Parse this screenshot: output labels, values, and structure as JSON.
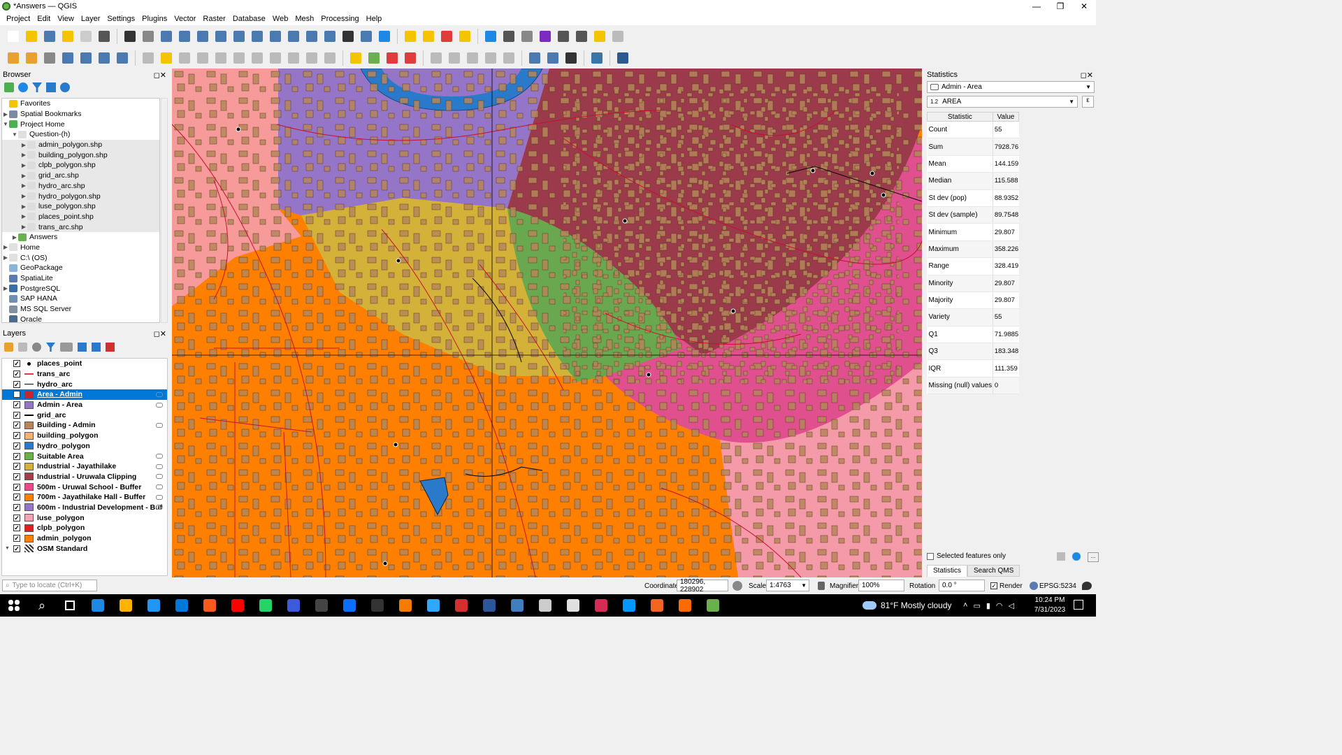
{
  "window": {
    "title": "*Answers — QGIS",
    "minimize": "—",
    "restore": "❐",
    "close": "✕"
  },
  "menu": [
    "Project",
    "Edit",
    "View",
    "Layer",
    "Settings",
    "Plugins",
    "Vector",
    "Raster",
    "Database",
    "Web",
    "Mesh",
    "Processing",
    "Help"
  ],
  "browser": {
    "title": "Browser",
    "items": [
      {
        "label": "Favorites",
        "indent": 0,
        "arrow": "",
        "icon": "#f5c400"
      },
      {
        "label": "Spatial Bookmarks",
        "indent": 0,
        "arrow": "▶",
        "icon": "#7a8aa0"
      },
      {
        "label": "Project Home",
        "indent": 0,
        "arrow": "▼",
        "icon": "#4caf50"
      },
      {
        "label": "Question-(h)",
        "indent": 1,
        "arrow": "▼",
        "icon": "#e0e0e0"
      },
      {
        "label": "admin_polygon.shp",
        "indent": 2,
        "arrow": "▶",
        "icon": "#ddd"
      },
      {
        "label": "building_polygon.shp",
        "indent": 2,
        "arrow": "▶",
        "icon": "#ddd"
      },
      {
        "label": "clpb_polygon.shp",
        "indent": 2,
        "arrow": "▶",
        "icon": "#ddd"
      },
      {
        "label": "grid_arc.shp",
        "indent": 2,
        "arrow": "▶",
        "icon": "#ddd"
      },
      {
        "label": "hydro_arc.shp",
        "indent": 2,
        "arrow": "▶",
        "icon": "#ddd"
      },
      {
        "label": "hydro_polygon.shp",
        "indent": 2,
        "arrow": "▶",
        "icon": "#ddd"
      },
      {
        "label": "luse_polygon.shp",
        "indent": 2,
        "arrow": "▶",
        "icon": "#ddd"
      },
      {
        "label": "places_point.shp",
        "indent": 2,
        "arrow": "▶",
        "icon": "#ddd"
      },
      {
        "label": "trans_arc.shp",
        "indent": 2,
        "arrow": "▶",
        "icon": "#ddd"
      },
      {
        "label": "Answers",
        "indent": 1,
        "arrow": "▶",
        "icon": "#6ab04c"
      },
      {
        "label": "Home",
        "indent": 0,
        "arrow": "▶",
        "icon": "#e0e0e0"
      },
      {
        "label": "C:\\ (OS)",
        "indent": 0,
        "arrow": "▶",
        "icon": "#e0e0e0"
      },
      {
        "label": "GeoPackage",
        "indent": 0,
        "arrow": "",
        "icon": "#8ab4d8"
      },
      {
        "label": "SpatiaLite",
        "indent": 0,
        "arrow": "",
        "icon": "#5a7ab0"
      },
      {
        "label": "PostgreSQL",
        "indent": 0,
        "arrow": "▶",
        "icon": "#3a6ea5"
      },
      {
        "label": "SAP HANA",
        "indent": 0,
        "arrow": "",
        "icon": "#7090b0"
      },
      {
        "label": "MS SQL Server",
        "indent": 0,
        "arrow": "",
        "icon": "#8090a0"
      },
      {
        "label": "Oracle",
        "indent": 0,
        "arrow": "",
        "icon": "#4a6a90"
      }
    ]
  },
  "layers": {
    "title": "Layers",
    "items": [
      {
        "label": "places_point",
        "sym": "point",
        "color": "#000000",
        "selected": false,
        "eye": false
      },
      {
        "label": "trans_arc",
        "sym": "line",
        "color": "#e03c3c",
        "selected": false,
        "eye": false
      },
      {
        "label": "hydro_arc",
        "sym": "line",
        "color": "#000000",
        "selected": false,
        "eye": false
      },
      {
        "label": "Area - Admin",
        "sym": "fill",
        "color": "#c8262e",
        "selected": true,
        "eye": true
      },
      {
        "label": "Admin - Area",
        "sym": "fill",
        "color": "#9575c8",
        "selected": false,
        "eye": true
      },
      {
        "label": "grid_arc",
        "sym": "line",
        "color": "#000000",
        "selected": false,
        "eye": false
      },
      {
        "label": "Building - Admin",
        "sym": "fill",
        "color": "#b5865a",
        "selected": false,
        "eye": true
      },
      {
        "label": "building_polygon",
        "sym": "fill",
        "color": "#f4b26a",
        "selected": false,
        "eye": false
      },
      {
        "label": "hydro_polygon",
        "sym": "fill",
        "color": "#2a7acc",
        "selected": false,
        "eye": false
      },
      {
        "label": "Suitable Area",
        "sym": "fill",
        "color": "#6ab04c",
        "selected": false,
        "eye": true
      },
      {
        "label": "Industrial - Jayathilake",
        "sym": "fill",
        "color": "#d4b23a",
        "selected": false,
        "eye": true
      },
      {
        "label": "Industrial - Uruwala Clipping",
        "sym": "fill",
        "color": "#a83a4a",
        "selected": false,
        "eye": true
      },
      {
        "label": "500m - Uruwal School - Buffer",
        "sym": "fill",
        "color": "#e84a8a",
        "selected": false,
        "eye": true
      },
      {
        "label": "700m - Jayathilake Hall - Buffer",
        "sym": "fill",
        "color": "#ff8000",
        "selected": false,
        "eye": true
      },
      {
        "label": "600m - Industrial Development - Buf",
        "sym": "fill",
        "color": "#9575c8",
        "selected": false,
        "eye": true
      },
      {
        "label": "luse_polygon",
        "sym": "fill",
        "color": "#f4a4b4",
        "selected": false,
        "eye": false
      },
      {
        "label": "clpb_polygon",
        "sym": "fill",
        "color": "#e02020",
        "selected": false,
        "eye": false
      },
      {
        "label": "admin_polygon",
        "sym": "fill",
        "color": "#ff8000",
        "selected": false,
        "eye": false
      },
      {
        "label": "OSM Standard",
        "sym": "grid",
        "color": "#333333",
        "selected": false,
        "eye": false
      }
    ]
  },
  "stats": {
    "title": "Statistics",
    "layer": "Admin - Area",
    "field_prefix": "1.2",
    "field": "AREA",
    "col_stat": "Statistic",
    "col_value": "Value",
    "rows": [
      {
        "k": "Count",
        "v": "55"
      },
      {
        "k": "Sum",
        "v": "7928.76"
      },
      {
        "k": "Mean",
        "v": "144.159"
      },
      {
        "k": "Median",
        "v": "115.588"
      },
      {
        "k": "St dev (pop)",
        "v": "88.9352"
      },
      {
        "k": "St dev (sample)",
        "v": "89.7548"
      },
      {
        "k": "Minimum",
        "v": "29.807"
      },
      {
        "k": "Maximum",
        "v": "358.226"
      },
      {
        "k": "Range",
        "v": "328.419"
      },
      {
        "k": "Minority",
        "v": "29.807"
      },
      {
        "k": "Majority",
        "v": "29.807"
      },
      {
        "k": "Variety",
        "v": "55"
      },
      {
        "k": "Q1",
        "v": "71.9885"
      },
      {
        "k": "Q3",
        "v": "183.348"
      },
      {
        "k": "IQR",
        "v": "111.359"
      },
      {
        "k": "Missing (null) values",
        "v": "0"
      }
    ],
    "selected_only": "Selected features only",
    "tab_stats": "Statistics",
    "tab_qms": "Search QMS"
  },
  "status": {
    "locate_placeholder": "Type to locate (Ctrl+K)",
    "coord_label": "Coordinate",
    "coord_value": "180296, 228902",
    "scale_label": "Scale",
    "scale_value": "1:4763",
    "magnifier_label": "Magnifier",
    "magnifier_value": "100%",
    "rotation_label": "Rotation",
    "rotation_value": "0.0 °",
    "render_label": "Render",
    "crs": "EPSG:5234"
  },
  "taskbar": {
    "weather": "81°F  Mostly cloudy",
    "time": "10:24 PM",
    "date": "7/31/2023",
    "apps": [
      "#1e88e5",
      "#ffb300",
      "#2196f3",
      "#0078d7",
      "#fb5a1e",
      "#ff0000",
      "#25d366",
      "#3b5bdb",
      "#444",
      "#0d6efd",
      "#333",
      "#f57c00",
      "#31a8ff",
      "#d32f2f",
      "#2b579a",
      "#3f7fbf",
      "#ccc",
      "#e0e0e0",
      "#d62b55",
      "#0098ff",
      "#f26522",
      "#ff6b00",
      "#6ab04c"
    ]
  }
}
